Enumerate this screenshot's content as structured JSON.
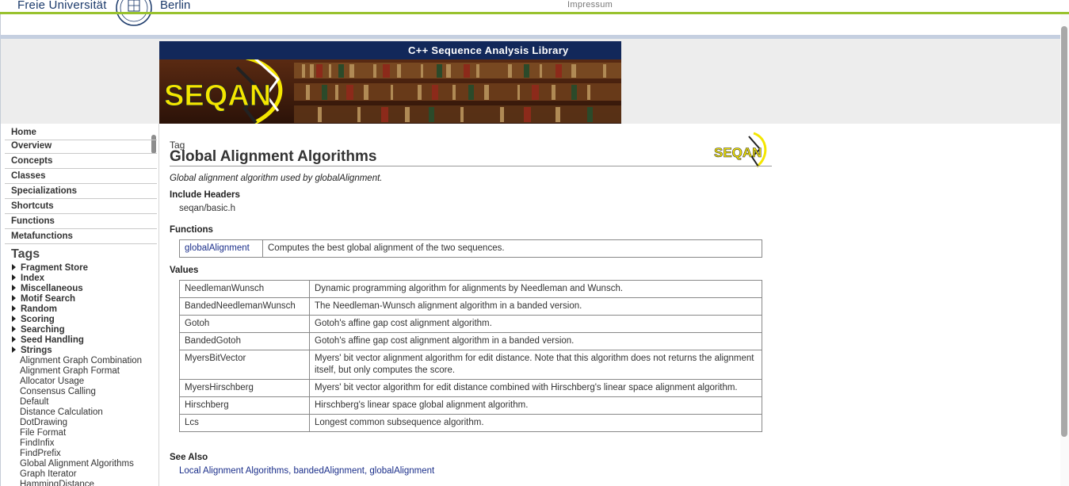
{
  "header": {
    "uni_name_left": "Freie Universität",
    "uni_name_right": "Berlin",
    "impressum": "Impressum"
  },
  "banner": {
    "title": "C++ Sequence Analysis Library",
    "logo_text": "SEQAN"
  },
  "nav": {
    "items": [
      "Home",
      "Overview",
      "Concepts",
      "Classes",
      "Specializations",
      "Shortcuts",
      "Functions",
      "Metafunctions"
    ],
    "tags_heading": "Tags",
    "tag_categories": [
      "Fragment Store",
      "Index",
      "Miscellaneous",
      "Motif Search",
      "Random",
      "Scoring",
      "Searching",
      "Seed Handling",
      "Strings"
    ],
    "tag_links": [
      "Alignment Graph Combination",
      "Alignment Graph Format",
      "Allocator Usage",
      "Consensus Calling",
      "Default",
      "Distance Calculation",
      "DotDrawing",
      "File Format",
      "FindInfix",
      "FindPrefix",
      "Global Alignment Algorithms",
      "Graph Iterator",
      "HammingDistance"
    ]
  },
  "page": {
    "kind": "Tag",
    "title": "Global Alignment Algorithms",
    "description": "Global alignment algorithm used by globalAlignment.",
    "include_heading": "Include Headers",
    "include_file": "seqan/basic.h",
    "functions_heading": "Functions",
    "functions": [
      {
        "name": "globalAlignment",
        "desc": "Computes the best global alignment of the two sequences."
      }
    ],
    "values_heading": "Values",
    "values": [
      {
        "name": "NeedlemanWunsch",
        "desc": "Dynamic programming algorithm for alignments by Needleman and Wunsch."
      },
      {
        "name": "BandedNeedlemanWunsch",
        "desc": "The Needleman-Wunsch alignment algorithm in a banded version."
      },
      {
        "name": "Gotoh",
        "desc": "Gotoh's affine gap cost alignment algorithm."
      },
      {
        "name": "BandedGotoh",
        "desc": "Gotoh's affine gap cost alignment algorithm in a banded version."
      },
      {
        "name": "MyersBitVector",
        "desc": "Myers' bit vector alignment algorithm for edit distance. Note that this algorithm does not returns the alignment itself, but only computes the score."
      },
      {
        "name": "MyersHirschberg",
        "desc": "Myers' bit vector algorithm for edit distance combined with Hirschberg's linear space alignment algorithm."
      },
      {
        "name": "Hirschberg",
        "desc": "Hirschberg's linear space global alignment algorithm."
      },
      {
        "name": "Lcs",
        "desc": "Longest common subsequence algorithm."
      }
    ],
    "see_also_heading": "See Also",
    "see_also": [
      "Local Alignment Algorithms",
      "bandedAlignment",
      "globalAlignment"
    ]
  },
  "colors": {
    "green_line": "#99c22e",
    "banner_navy": "#12285a",
    "link": "#1a2e8a"
  }
}
